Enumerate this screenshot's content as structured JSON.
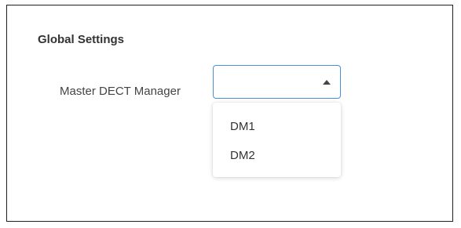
{
  "section": {
    "title": "Global Settings"
  },
  "master_dect_manager": {
    "label": "Master DECT Manager",
    "value": "",
    "icon": "caret-up-icon",
    "options": [
      "DM1",
      "DM2"
    ]
  },
  "colors": {
    "accent": "#4a90d9",
    "text": "#333333",
    "border": "#1f1f1f"
  }
}
